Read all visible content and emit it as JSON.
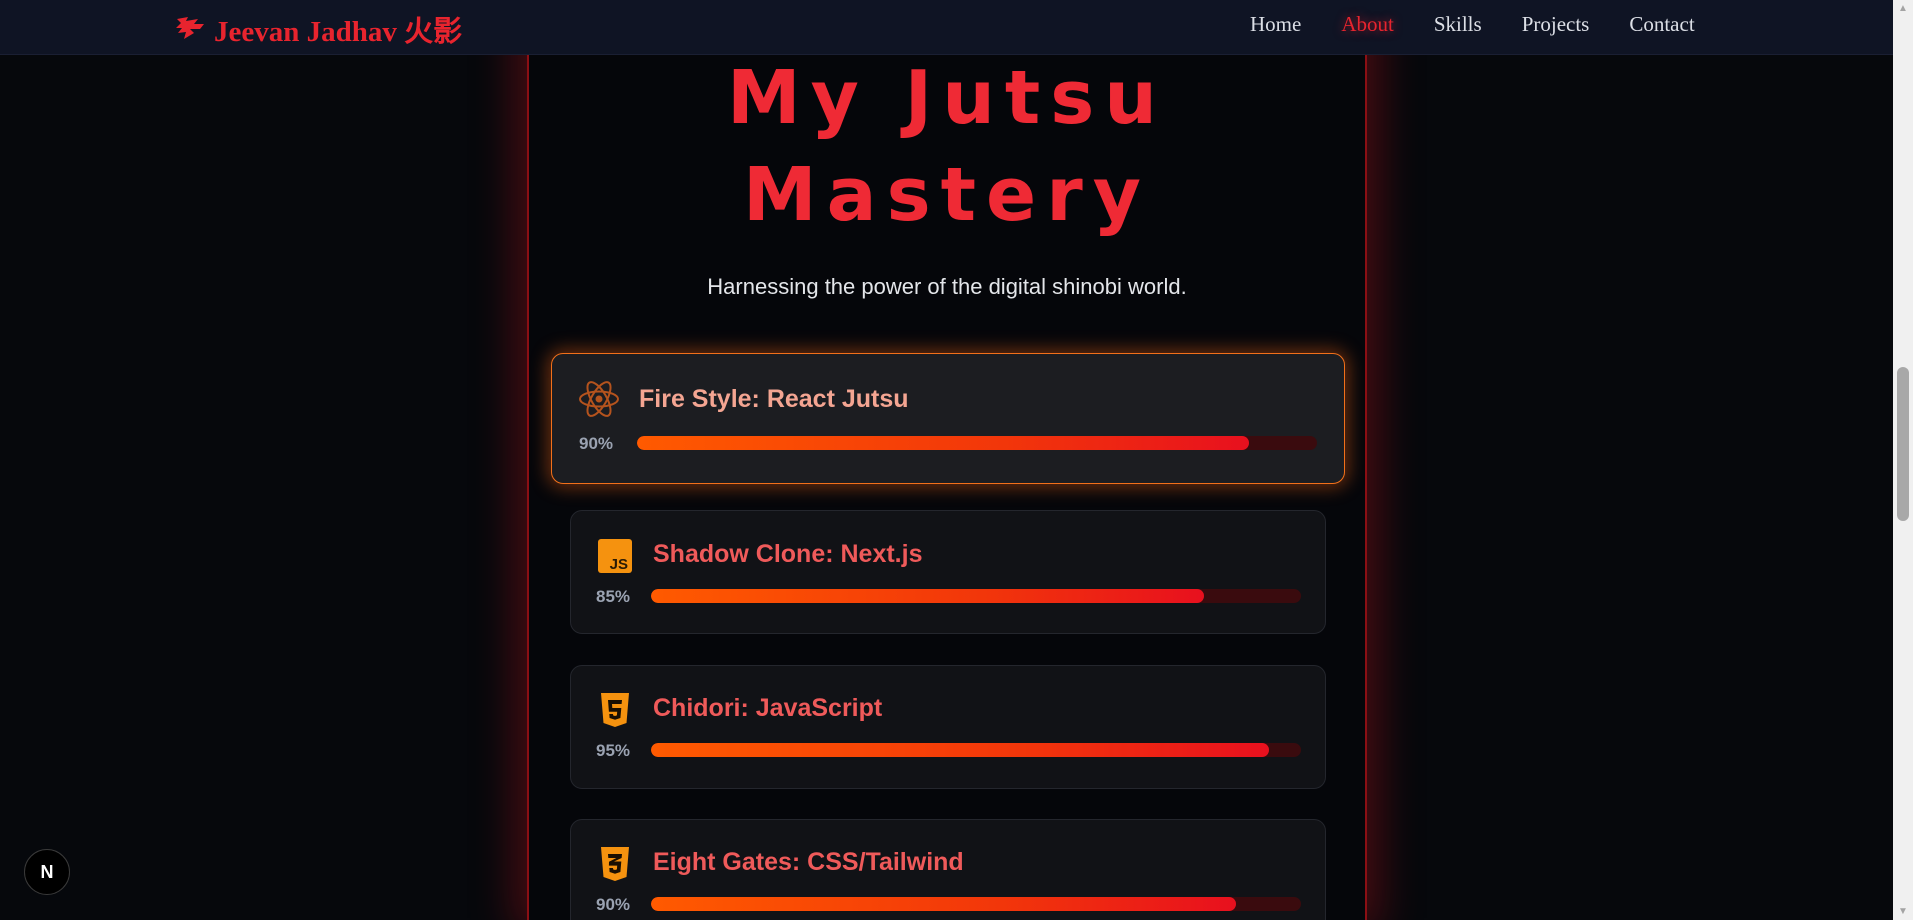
{
  "brand": {
    "name": "Jeevan Jadhav 火影",
    "icon": "ninja-logo-icon"
  },
  "nav": {
    "items": [
      {
        "label": "Home",
        "active": false
      },
      {
        "label": "About",
        "active": true
      },
      {
        "label": "Skills",
        "active": false
      },
      {
        "label": "Projects",
        "active": false
      },
      {
        "label": "Contact",
        "active": false
      }
    ]
  },
  "hero": {
    "title_line1": "My Jutsu",
    "title_line2": "Mastery",
    "subtitle": "Harnessing the power of the digital shinobi world."
  },
  "skills": [
    {
      "title": "Fire Style: React Jutsu",
      "percent_label": "90%",
      "level": 90,
      "icon": "react-icon"
    },
    {
      "title": "Shadow Clone: Next.js",
      "percent_label": "85%",
      "level": 85,
      "icon": "javascript-icon"
    },
    {
      "title": "Chidori: JavaScript",
      "percent_label": "95%",
      "level": 95,
      "icon": "html5-icon"
    },
    {
      "title": "Eight Gates: CSS/Tailwind",
      "percent_label": "90%",
      "level": 90,
      "icon": "css3-icon"
    }
  ],
  "badge": {
    "label": "N"
  },
  "colors": {
    "accent": "#e8242e",
    "bar_start": "#ff5a00",
    "bar_end": "#e8101e",
    "card_border_featured": "#f2701a",
    "nav_bg": "#0f1424"
  }
}
